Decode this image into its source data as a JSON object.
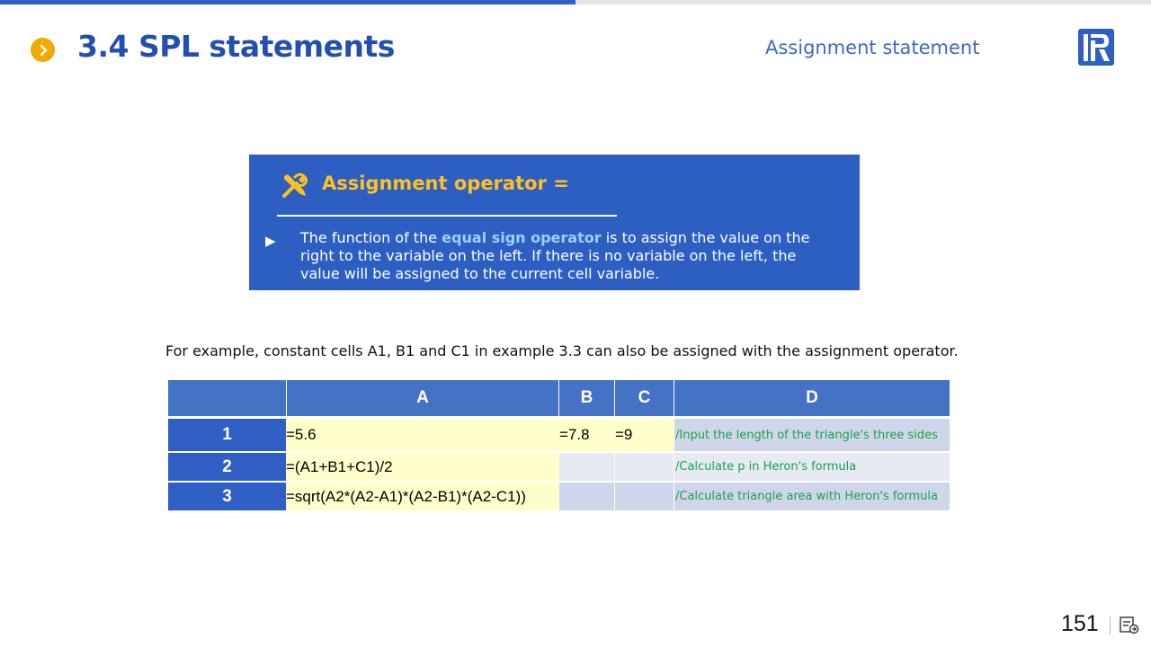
{
  "header": {
    "title": "3.4 SPL statements",
    "section": "Assignment statement",
    "icons": [
      "chevron-right-icon",
      "raqsoft-logo"
    ]
  },
  "infobox": {
    "heading": "Assignment operator =",
    "text_before": "The function of the ",
    "text_highlight": "equal sign operator",
    "text_after": " is to assign the value on the right to the variable on the left. If there is no variable on the left, the value will be assigned to the current cell variable.",
    "icon": "tools-icon"
  },
  "example_text": "For example, constant cells A1, B1 and C1 in example 3.3 can also be assigned with the assignment operator.",
  "grid": {
    "columns": [
      "A",
      "B",
      "C",
      "D"
    ],
    "rows": [
      {
        "num": "1",
        "A": "=5.6",
        "B": "=7.8",
        "C": "=9",
        "D": "/Input the length of the triangle's three sides"
      },
      {
        "num": "2",
        "A": "=(A1+B1+C1)/2",
        "B": "",
        "C": "",
        "D": "/Calculate p in Heron's formula"
      },
      {
        "num": "3",
        "A": "=sqrt(A2*(A2-A1)*(A2-B1)*(A2-C1))",
        "B": "",
        "C": "",
        "D": "/Calculate triangle area with Heron's formula"
      }
    ]
  },
  "footer": {
    "page_number": "151",
    "icon": "notes-icon"
  },
  "colors": {
    "brand_blue": "#2d5fc3",
    "accent_yellow": "#ffc11e",
    "comment_green": "#16a34a"
  }
}
